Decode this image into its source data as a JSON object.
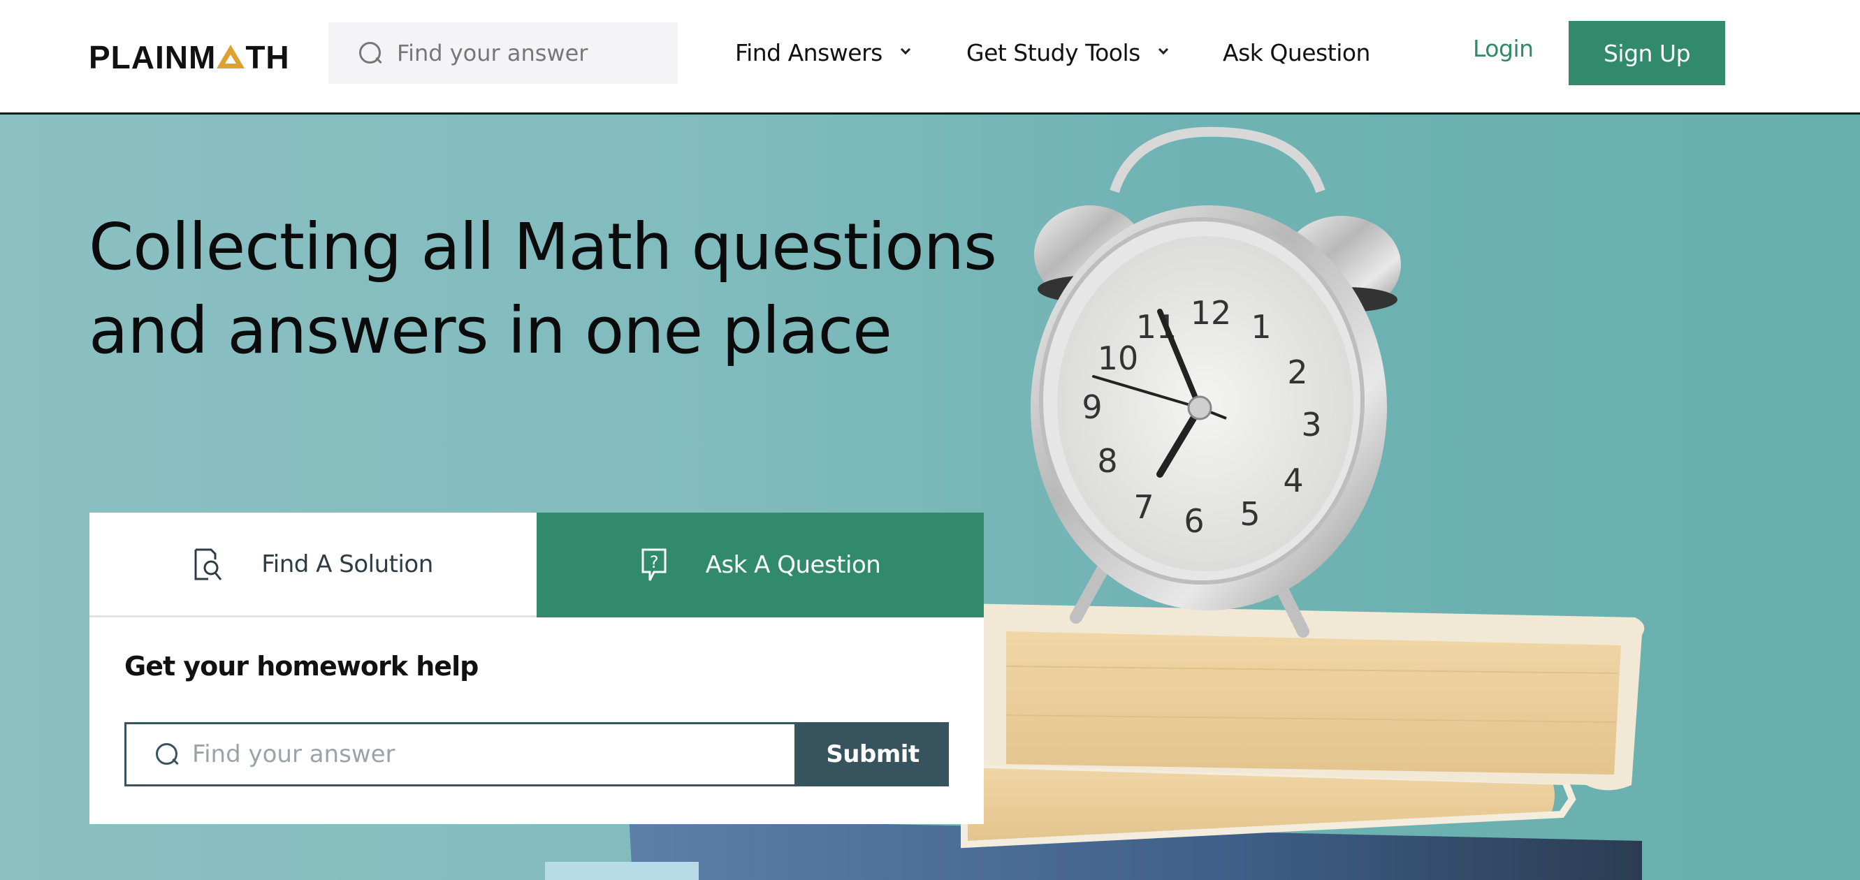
{
  "header": {
    "logo": {
      "text_before": "PLAINM",
      "text_after": "TH",
      "accent_color": "#e0a030"
    },
    "search": {
      "placeholder": "Find your answer",
      "value": ""
    },
    "nav": [
      {
        "label": "Find Answers",
        "has_dropdown": true
      },
      {
        "label": "Get Study Tools",
        "has_dropdown": true
      },
      {
        "label": "Ask Question",
        "has_dropdown": false
      }
    ],
    "login_label": "Login",
    "signup_label": "Sign Up"
  },
  "hero": {
    "heading_line1": "Collecting all Math questions",
    "heading_line2": "and answers in one place",
    "image_alt": "alarm clock on stack of books",
    "clock_numbers": [
      "12",
      "1",
      "2",
      "3",
      "4",
      "5",
      "6",
      "7",
      "8",
      "9",
      "10",
      "11"
    ]
  },
  "card": {
    "tabs": [
      {
        "label": "Find A Solution",
        "icon": "document-search-icon",
        "active": false
      },
      {
        "label": "Ask A Question",
        "icon": "question-bubble-icon",
        "active": true
      }
    ],
    "title": "Get your homework help",
    "search": {
      "placeholder": "Find your answer",
      "value": ""
    },
    "submit_label": "Submit"
  },
  "colors": {
    "brand_green": "#318a6b",
    "dark_slate": "#37535e",
    "hero_teal": "#6fb2b3",
    "logo_accent": "#e0a030"
  }
}
